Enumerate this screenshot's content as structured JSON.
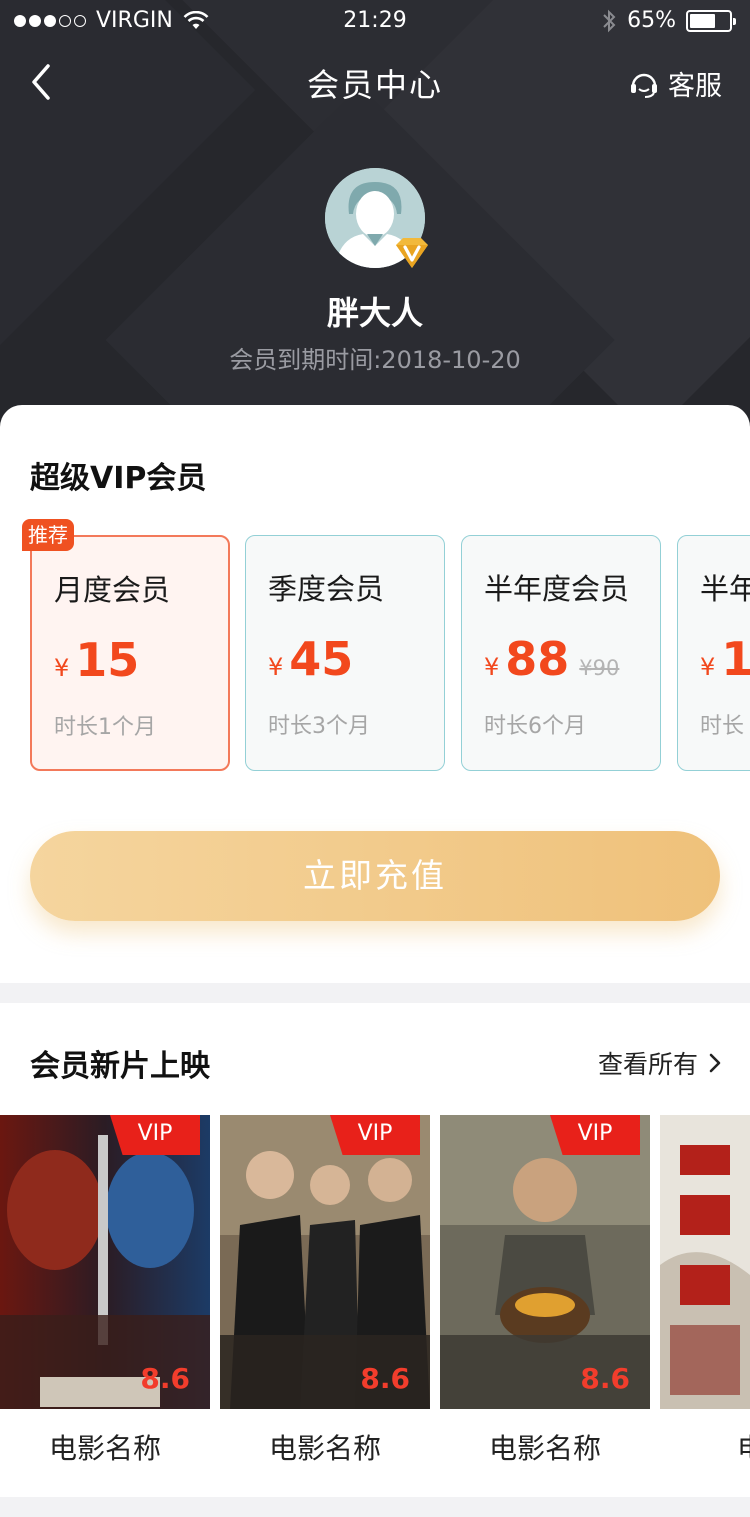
{
  "status_bar": {
    "carrier": "VIRGIN",
    "time": "21:29",
    "battery": "65%",
    "battery_level": 0.65
  },
  "nav": {
    "title": "会员中心",
    "service_label": "客服"
  },
  "profile": {
    "username": "胖大人",
    "expire_text": "会员到期时间:2018-10-20"
  },
  "vip_section": {
    "title": "超级VIP会员",
    "recommend_badge": "推荐",
    "plans": [
      {
        "name": "月度会员",
        "currency": "¥",
        "price": "15",
        "original": "",
        "duration": "时长1个月",
        "selected": true
      },
      {
        "name": "季度会员",
        "currency": "¥",
        "price": "45",
        "original": "",
        "duration": "时长3个月",
        "selected": false
      },
      {
        "name": "半年度会员",
        "currency": "¥",
        "price": "88",
        "original": "¥90",
        "duration": "时长6个月",
        "selected": false
      },
      {
        "name": "半年",
        "currency": "¥",
        "price": "1",
        "original": "",
        "duration": "时长",
        "selected": false
      }
    ],
    "charge_button": "立即充值"
  },
  "movies_section": {
    "title": "会员新片上映",
    "see_all": "查看所有",
    "items": [
      {
        "name": "电影名称",
        "vip": "VIP",
        "score": "8.6"
      },
      {
        "name": "电影名称",
        "vip": "VIP",
        "score": "8.6"
      },
      {
        "name": "电影名称",
        "vip": "VIP",
        "score": "8.6"
      },
      {
        "name": "电影",
        "vip": "",
        "score": ""
      }
    ]
  },
  "colors": {
    "header_bg": "#26272c",
    "accent_red": "#f2481d",
    "selected_border": "#f3795a",
    "plan_border": "#93d0d6",
    "button_gold": "#efc17a",
    "vip_tag": "#e8211a"
  }
}
